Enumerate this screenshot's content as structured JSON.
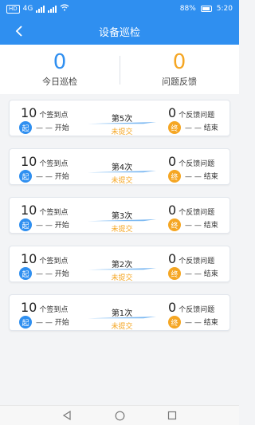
{
  "status_bar": {
    "carrier_chip": "HD",
    "network": "4G",
    "battery": "88%",
    "time": "5:20"
  },
  "header": {
    "title": "设备巡检",
    "back_icon": "chevron-left-icon"
  },
  "summary": {
    "today_count": "0",
    "today_label": "今日巡检",
    "issue_count": "0",
    "issue_label": "问题反馈",
    "today_color": "#2f8ff0",
    "issue_color": "#f5a623"
  },
  "inspections": [
    {
      "points": "10",
      "points_unit": "个签到点",
      "start_badge": "起",
      "start_time": "— — 开始",
      "round": "第5次",
      "status": "未提交",
      "issues": "0",
      "issues_unit": "个反馈问题",
      "end_badge": "终",
      "end_time": "— — 结束"
    },
    {
      "points": "10",
      "points_unit": "个签到点",
      "start_badge": "起",
      "start_time": "— — 开始",
      "round": "第4次",
      "status": "未提交",
      "issues": "0",
      "issues_unit": "个反馈问题",
      "end_badge": "终",
      "end_time": "— — 结束"
    },
    {
      "points": "10",
      "points_unit": "个签到点",
      "start_badge": "起",
      "start_time": "— — 开始",
      "round": "第3次",
      "status": "未提交",
      "issues": "0",
      "issues_unit": "个反馈问题",
      "end_badge": "终",
      "end_time": "— — 结束"
    },
    {
      "points": "10",
      "points_unit": "个签到点",
      "start_badge": "起",
      "start_time": "— — 开始",
      "round": "第2次",
      "status": "未提交",
      "issues": "0",
      "issues_unit": "个反馈问题",
      "end_badge": "终",
      "end_time": "— — 结束"
    },
    {
      "points": "10",
      "points_unit": "个签到点",
      "start_badge": "起",
      "start_time": "— — 开始",
      "round": "第1次",
      "status": "未提交",
      "issues": "0",
      "issues_unit": "个反馈问题",
      "end_badge": "终",
      "end_time": "— — 结束"
    }
  ],
  "nav": {
    "back_icon": "triangle-back-icon",
    "home_icon": "circle-home-icon",
    "recents_icon": "square-recents-icon"
  }
}
